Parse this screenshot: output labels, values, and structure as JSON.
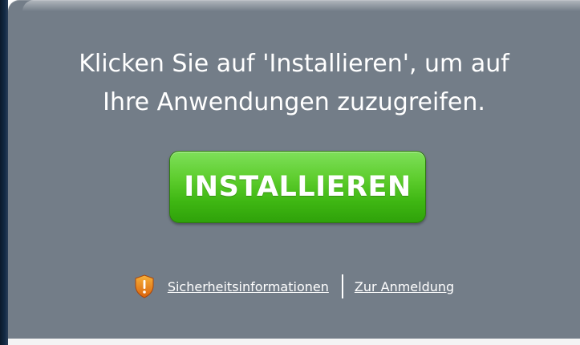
{
  "dialog": {
    "message_line1": "Klicken Sie auf 'Installieren', um auf",
    "message_line2": "Ihre Anwendungen zuzugreifen.",
    "install_button": "INSTALLIEREN",
    "security_link": "Sicherheitsinformationen",
    "login_link": "Zur Anmeldung",
    "icon": "shield-warning-icon"
  },
  "colors": {
    "background": "#737d88",
    "button_green": "#3fb713",
    "shield_orange": "#e07a12",
    "text": "#ffffff"
  }
}
